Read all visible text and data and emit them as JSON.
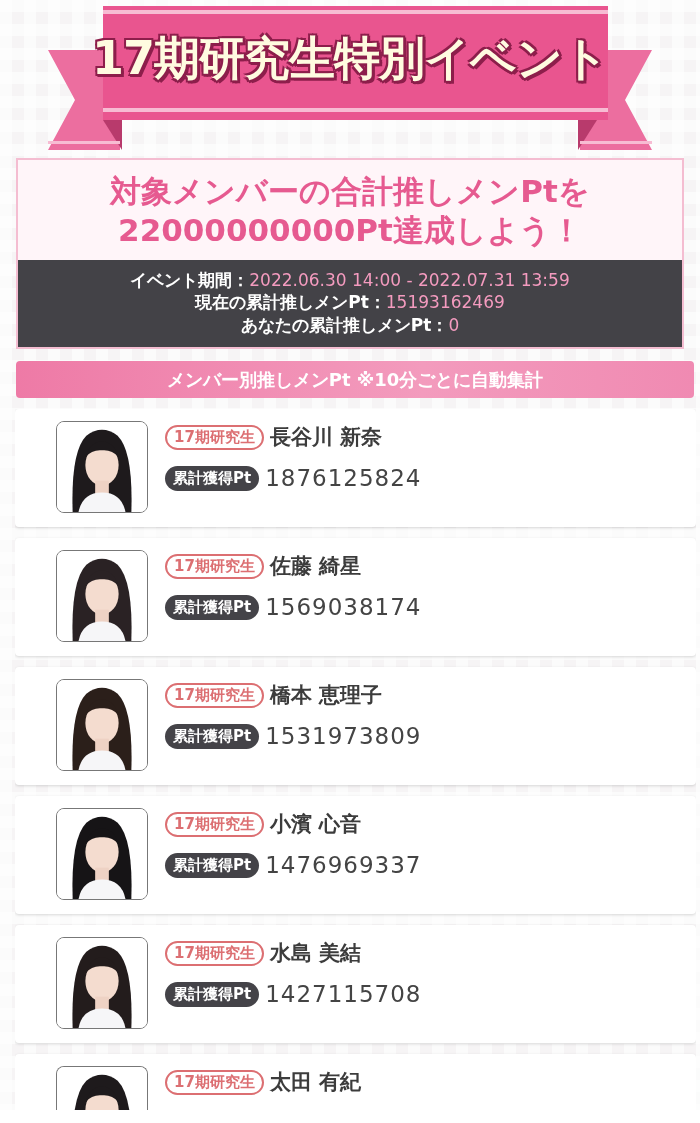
{
  "banner": {
    "title": "17期研究生特別イベント"
  },
  "goal": {
    "lines": [
      "対象メンバーの合計推しメンPtを",
      "22000000000Pt達成しよう！"
    ],
    "info": [
      {
        "label": "イベント期間：",
        "value": "2022.06.30 14:00 - 2022.07.31 13:59"
      },
      {
        "label": "現在の累計推しメンPt：",
        "value": "15193162469"
      },
      {
        "label": "あなたの累計推しメンPt：",
        "value": "0"
      }
    ]
  },
  "section": {
    "title": "メンバー別推しメンPt ※10分ごとに自動集計"
  },
  "members": [
    {
      "badge": "17期研究生",
      "name": "長谷川 新奈",
      "pt_label": "累計獲得Pt",
      "points": "1876125824"
    },
    {
      "badge": "17期研究生",
      "name": "佐藤 綺星",
      "pt_label": "累計獲得Pt",
      "points": "1569038174"
    },
    {
      "badge": "17期研究生",
      "name": "橋本 恵理子",
      "pt_label": "累計獲得Pt",
      "points": "1531973809"
    },
    {
      "badge": "17期研究生",
      "name": "小濱 心音",
      "pt_label": "累計獲得Pt",
      "points": "1476969337"
    },
    {
      "badge": "17期研究生",
      "name": "水島 美結",
      "pt_label": "累計獲得Pt",
      "points": "1427115708"
    },
    {
      "badge": "17期研究生",
      "name": "太田 有紀"
    }
  ]
}
